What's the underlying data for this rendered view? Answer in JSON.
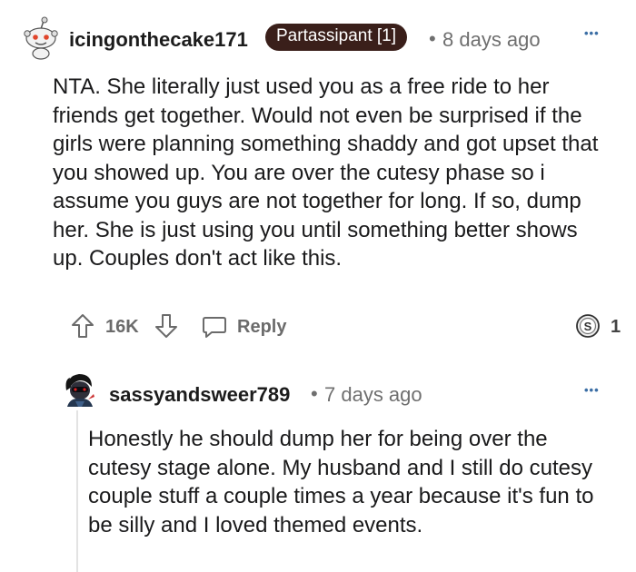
{
  "comment": {
    "username": "icingonthecake171",
    "flair": "Partassipant [1]",
    "separator": "•",
    "time": "8 days ago",
    "more": "•••",
    "body": "NTA. She literally just used you as a free ride to her friends get together. Would not even be surprised if the girls were planning something shaddy and got upset that you showed up. You are over the cutesy phase so i assume you guys are not together for long. If so, dump her. She is just using you until something better shows up. Couples don't act like this.",
    "vote_count": "16K",
    "reply_label": "Reply",
    "award_count": "1",
    "icons": [
      "snoo-avatar-icon",
      "upvote-icon",
      "downvote-icon",
      "chat-bubble-icon",
      "silver-award-icon",
      "more-options-icon"
    ]
  },
  "reply": {
    "username": "sassyandsweer789",
    "separator": "•",
    "time": "7 days ago",
    "more": "•••",
    "body": "Honestly he should dump her for being over the cutesy stage alone. My husband and I still do cutesy couple stuff a couple times a year because it's fun to be silly and I loved themed events.",
    "icons": [
      "user-avatar-icon",
      "more-options-icon"
    ]
  },
  "colors": {
    "flair_bg": "#3a1f1a",
    "link_blue": "#3b6ea5",
    "muted_gray": "#6f6f6f",
    "action_gray": "#6b6b6b"
  }
}
